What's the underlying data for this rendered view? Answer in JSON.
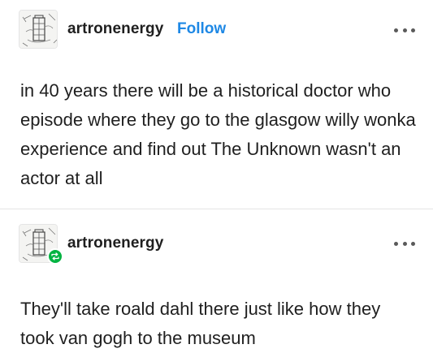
{
  "posts": [
    {
      "username": "artronenergy",
      "follow_label": "Follow",
      "body": "in 40 years there will be a historical doctor who episode where they go to the glasgow willy wonka experience and find out The Unknown wasn't an actor at all",
      "avatar_icon": "tardis-sketch-avatar"
    },
    {
      "username": "artronenergy",
      "body": "They'll take roald dahl there just like how they took van gogh to the museum",
      "avatar_icon": "tardis-sketch-avatar",
      "badge_icon": "reblog-icon"
    }
  ],
  "colors": {
    "follow": "#1e88e5",
    "reblog_badge": "#00b341",
    "text": "#1f1f1f"
  }
}
